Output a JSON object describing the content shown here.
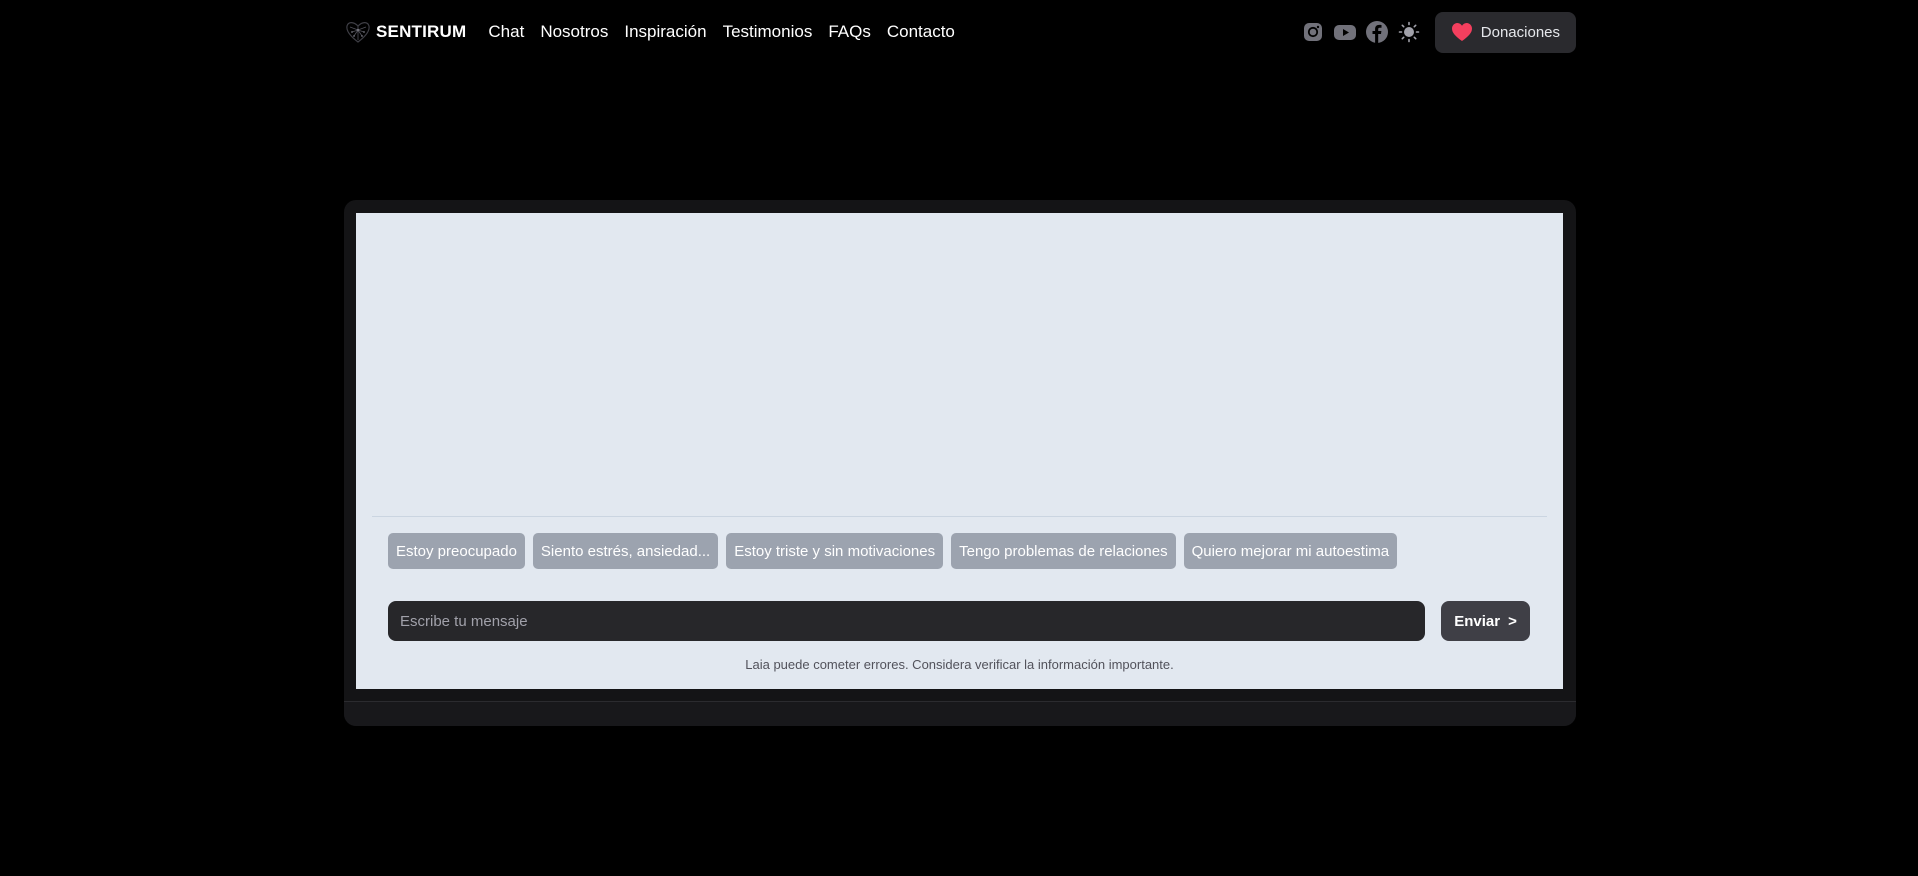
{
  "brand": {
    "name": "SENTIRUM",
    "logo_icon": "heart-mesh-logo-icon"
  },
  "nav": {
    "items": [
      {
        "label": "Chat"
      },
      {
        "label": "Nosotros"
      },
      {
        "label": "Inspiración"
      },
      {
        "label": "Testimonios"
      },
      {
        "label": "FAQs"
      },
      {
        "label": "Contacto"
      }
    ]
  },
  "social": {
    "icons": [
      "instagram-icon",
      "youtube-icon",
      "facebook-icon",
      "sun-icon"
    ]
  },
  "donate": {
    "label": "Donaciones",
    "icon": "heart-icon",
    "icon_color": "#f43f5e"
  },
  "chat": {
    "suggestions": [
      {
        "label": "Estoy preocupado"
      },
      {
        "label": "Siento estrés, ansiedad..."
      },
      {
        "label": "Estoy triste y sin motivaciones"
      },
      {
        "label": "Tengo problemas de relaciones"
      },
      {
        "label": "Quiero mejorar mi autoestima"
      }
    ],
    "input": {
      "placeholder": "Escribe tu mensaje",
      "value": ""
    },
    "send": {
      "label": "Enviar",
      "arrow": ">"
    },
    "disclaimer": "Laia puede cometer errores. Considera verificar la información importante."
  },
  "colors": {
    "background": "#000000",
    "panel": "#e2e8f0",
    "chip": "#9ca3af",
    "input": "#27272a",
    "accent_heart": "#f43f5e"
  }
}
